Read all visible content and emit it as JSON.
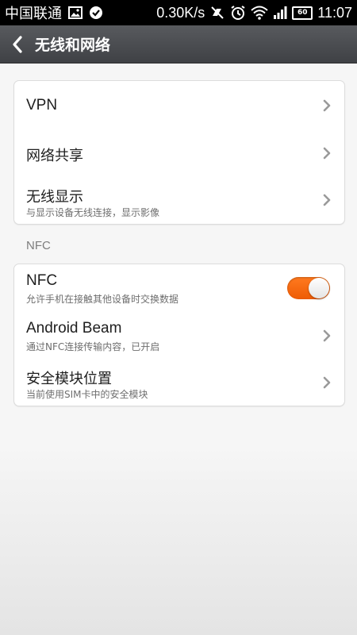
{
  "status_bar": {
    "carrier": "中国联通",
    "speed": "0.30K/s",
    "battery": "60",
    "time": "11:07",
    "icons": [
      "image-icon",
      "check-circle-icon",
      "no-sync-icon",
      "alarm-icon",
      "wifi-icon",
      "signal-icon",
      "battery-icon"
    ]
  },
  "header": {
    "title": "无线和网络",
    "back_icon": "back-arrow-icon"
  },
  "group1": {
    "items": [
      {
        "title": "VPN",
        "subtitle": ""
      },
      {
        "title": "网络共享",
        "subtitle": ""
      },
      {
        "title": "无线显示",
        "subtitle": "与显示设备无线连接，显示影像"
      }
    ]
  },
  "section_nfc": {
    "label": "NFC"
  },
  "group2": {
    "items": [
      {
        "title": "NFC",
        "subtitle": "允许手机在接触其他设备时交换数据",
        "toggle_on": true
      },
      {
        "title": "Android Beam",
        "subtitle": "通过NFC连接传输内容，已开启"
      },
      {
        "title": "安全模块位置",
        "subtitle": "当前使用SIM卡中的安全模块"
      }
    ]
  },
  "colors": {
    "toggle_on": "#f36a12",
    "header_bg": "#4a4c50",
    "page_bg": "#f6f6f6"
  }
}
